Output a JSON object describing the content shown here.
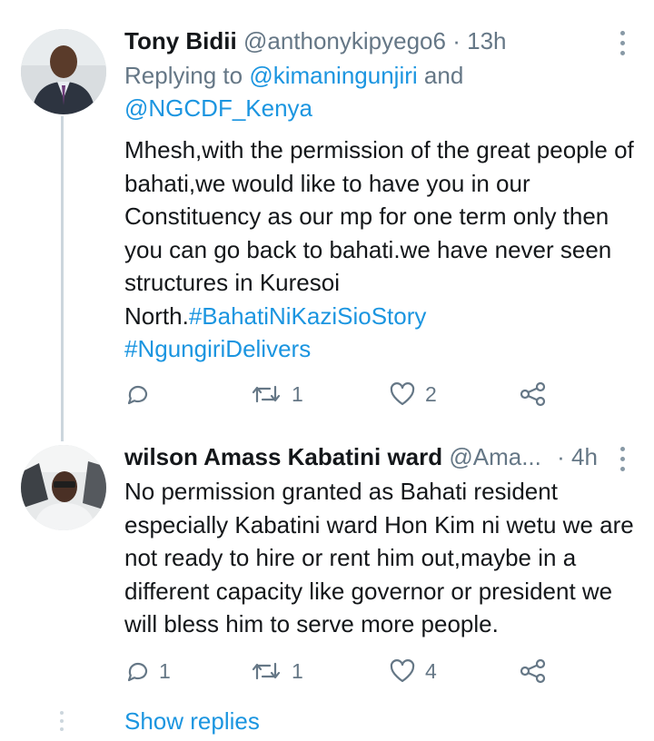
{
  "tweets": [
    {
      "name": "Tony Bidii",
      "handle": "@anthonykipyego6",
      "separator": "·",
      "time": "13h",
      "replying_prefix": "Replying to ",
      "replying_user1": "@kimaningunjiri",
      "replying_and": " and",
      "replying_user2": "@NGCDF_Kenya",
      "text": "Mhesh,with the permission of the great people of bahati,we would like to have you in our Constituency as our mp  for one term only then you can go back to bahati.we have never seen structures in Kuresoi North.",
      "hashtag1": "#BahatiNiKaziSioStory",
      "hashtag2": "#NgungiriDelivers",
      "reply_count": "",
      "retweet_count": "1",
      "like_count": "2"
    },
    {
      "name": "wilson Amass Kabatini ward",
      "handle": "@Ama...",
      "separator": "·",
      "time": "4h",
      "text": "No permission granted as Bahati resident especially Kabatini ward Hon Kim ni wetu we are not ready to hire or rent him out,maybe in a different capacity like governor or president we will bless him to serve more people.",
      "reply_count": "1",
      "retweet_count": "1",
      "like_count": "4"
    }
  ],
  "show_replies": "Show replies",
  "colors": {
    "link": "#1b95e0",
    "secondary": "#657786",
    "thread_line": "#ccd6dd"
  },
  "icons": [
    "reply-icon",
    "retweet-icon",
    "like-icon",
    "share-icon",
    "more-options-icon"
  ]
}
